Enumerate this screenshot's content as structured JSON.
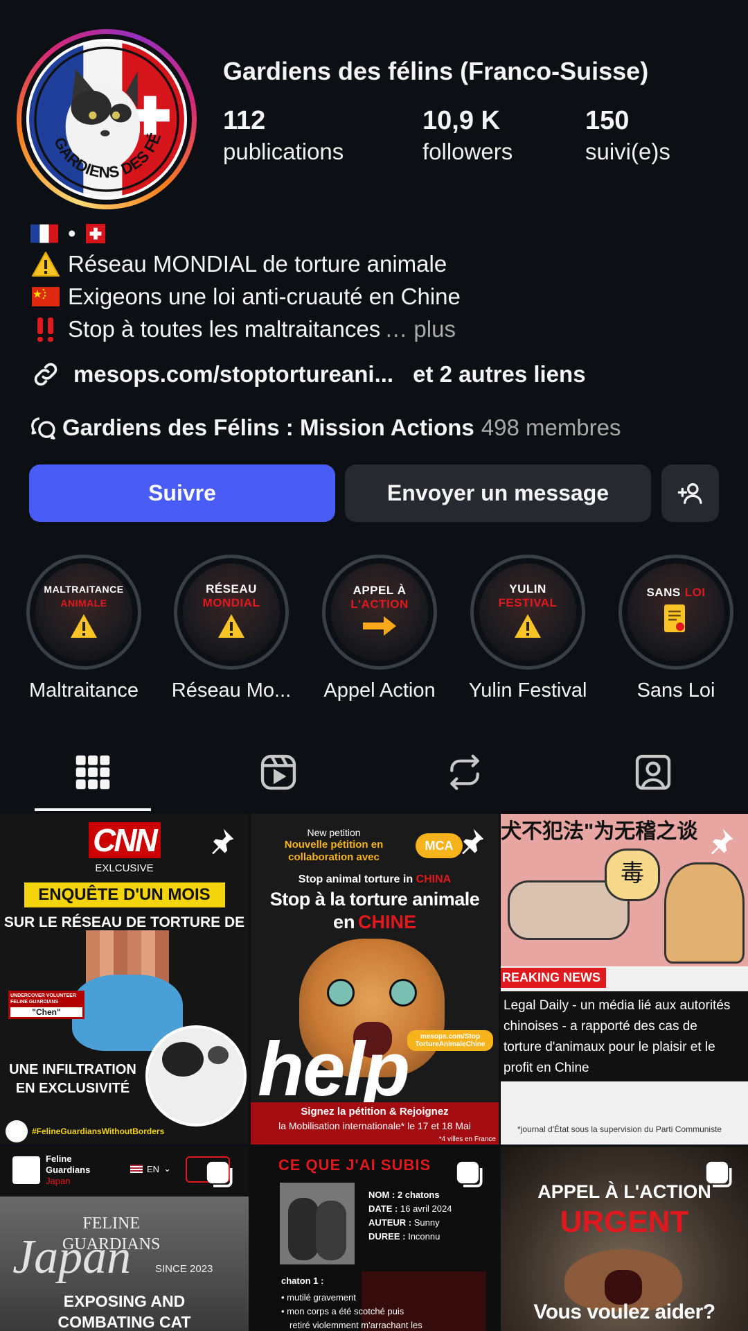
{
  "profile": {
    "name": "Gardiens des félins (Franco-Suisse)",
    "avatar_text": "GARDIENS DES FÉLINS",
    "stats": [
      {
        "value": "112",
        "label": "publications"
      },
      {
        "value": "10,9 K",
        "label": "followers"
      },
      {
        "value": "150",
        "label": "suivi(e)s"
      }
    ]
  },
  "bio": {
    "flags_separator": "•",
    "lines": [
      {
        "icon": "warning-icon",
        "text": "Réseau MONDIAL de torture animale"
      },
      {
        "icon": "china-flag-icon",
        "text": "Exigeons une loi anti-cruauté en Chine"
      },
      {
        "icon": "double-exclamation-icon",
        "text": "Stop à toutes les maltraitances"
      }
    ],
    "more": "… plus",
    "link": "mesops.com/stoptortureani...",
    "other_links": "et 2 autres liens"
  },
  "community": {
    "name": "Gardiens des Félins : Mission Actions",
    "members": "498 membres"
  },
  "actions": {
    "follow": "Suivre",
    "message": "Envoyer un message"
  },
  "highlights": [
    {
      "label": "Maltraitance",
      "t1": "MALTRAITANCE",
      "t2": "ANIMALE",
      "icon": "warning-icon"
    },
    {
      "label": "Réseau Mo...",
      "t1": "RÉSEAU",
      "t2": "MONDIAL",
      "icon": "warning-icon"
    },
    {
      "label": "Appel Action",
      "t1": "APPEL À",
      "t2": "L'ACTION",
      "icon": "arrow-right-icon"
    },
    {
      "label": "Yulin Festival",
      "t1": "YULIN",
      "t2": "FESTIVAL",
      "icon": "warning-icon"
    },
    {
      "label": "Sans Loi",
      "t1": "SANS",
      "t2": "LOI",
      "icon": "document-icon"
    }
  ],
  "posts": [
    {
      "brand": "CNN",
      "sub": "EXLCUSIVE",
      "banner": "ENQUÊTE D'UN MOIS",
      "headline": "SUR LE RÉSEAU DE TORTURE DE CHATS",
      "tag1": "UNDERCOVER VOLUNTEER FELINE GUARDIANS",
      "tag2": "\"Chen\"",
      "caption1": "UNE INFILTRATION",
      "caption2": "EN EXCLUSIVITÉ",
      "hashtag": "#FelineGuardiansWithoutBorders"
    },
    {
      "top1": "New petition",
      "top2": "Nouvelle pétition en",
      "top3": "collaboration avec",
      "badge": "MCA",
      "line_en_a": "Stop animal torture in",
      "line_en_b": "CHINA",
      "title_a": "Stop à la torture animale",
      "title_b": "en",
      "title_c": "CHINE",
      "url1": "mesops.com/Stop",
      "url2": "TortureAnimaleChine",
      "big": "help",
      "sign": "Signez la pétition & Rejoignez",
      "mob": "la Mobilisation internationale* le 17 et 18 Mai",
      "cities": "*4 villes en France"
    },
    {
      "hanzi_top": "犬不犯法\"为无稽之谈",
      "hanzi_poison": "毒",
      "breaking": "REAKING NEWS",
      "l1": "Legal Daily - un média lié aux autorités",
      "l2": "chinoises - a rapporté des cas de",
      "l3": "torture d'animaux pour le plaisir et le",
      "l4": "profit en Chine",
      "foot": "*journal d'État sous la supervision du Parti Communiste"
    },
    {
      "org1": "Feline",
      "org2": "Guardians",
      "org3": "Japan",
      "lang": "EN",
      "t1": "FELINE",
      "t2": "GUARDIANS",
      "script": "Japan",
      "since": "SINCE 2023",
      "b1": "EXPOSING AND",
      "b2": "COMBATING CAT"
    },
    {
      "title": "CE QUE J'AI SUBIS",
      "k1": "NOM :",
      "v1": "2 chatons",
      "k2": "DATE :",
      "v2": "16 avril 2024",
      "k3": "AUTEUR :",
      "v3": "Sunny",
      "k4": "DUREE :",
      "v4": "Inconnu",
      "sub": "chaton 1 :",
      "bul1": "mutilé gravement",
      "bul2": "mon corps a été scotché puis",
      "bul3": "retiré violemment m'arrachant les"
    },
    {
      "t1": "APPEL À L'ACTION",
      "t2": "URGENT",
      "bottom": "Vous voulez aider?"
    }
  ],
  "colors": {
    "follow": "#4a5cf6",
    "bg": "#0c1014",
    "alert_red": "#e0191f"
  }
}
